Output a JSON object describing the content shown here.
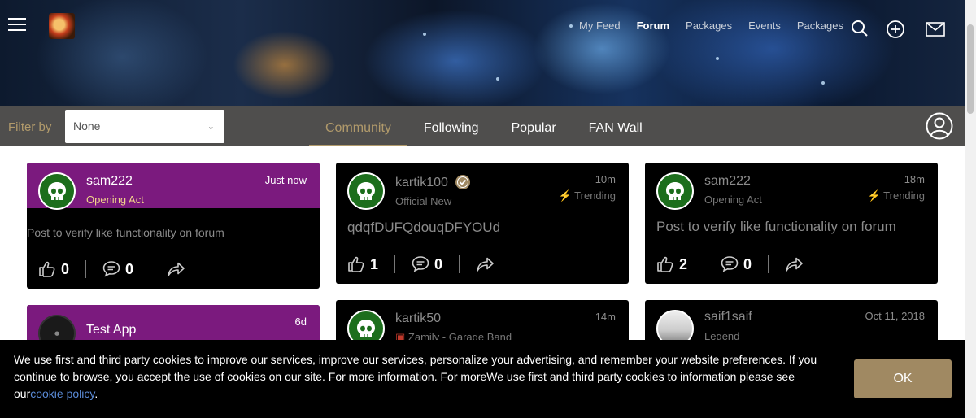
{
  "header": {
    "nav": [
      {
        "label": "My Feed",
        "active": false
      },
      {
        "label": "Forum",
        "active": true
      },
      {
        "label": "Packages",
        "active": false
      },
      {
        "label": "Events",
        "active": false
      },
      {
        "label": "Packages",
        "active": false
      }
    ],
    "icons": [
      "menu-icon",
      "search-icon",
      "add-icon",
      "mail-icon"
    ]
  },
  "filter": {
    "label": "Filter by",
    "selected": "None"
  },
  "tabs": [
    {
      "label": "Community",
      "active": true
    },
    {
      "label": "Following",
      "active": false
    },
    {
      "label": "Popular",
      "active": false
    },
    {
      "label": "FAN Wall",
      "active": false
    }
  ],
  "cards": [
    {
      "user": "sam222",
      "role": "Opening Act",
      "time": "Just now",
      "body": "Post to verify like functionality on forum",
      "likes": "0",
      "comments": "0"
    },
    {
      "user": "kartik100",
      "role": "Official New",
      "time": "10m",
      "trend": "Trending",
      "body": "qdqfDUFQdouqDFYOUd",
      "likes": "1",
      "comments": "0"
    },
    {
      "user": "sam222",
      "role": "Opening Act",
      "time": "18m",
      "trend": "Trending",
      "body": "Post to verify like functionality on forum",
      "likes": "2",
      "comments": "0"
    },
    {
      "user": "Test App",
      "time": "6d"
    },
    {
      "user": "kartik50",
      "role": "Zamily - Garage Band",
      "time": "14m"
    },
    {
      "user": "saif1saif",
      "role": "Legend",
      "time": "Oct 11, 2018"
    }
  ],
  "cookie": {
    "text": "We use first and third party cookies to improve our services, improve our services, personalize your advertising, and remember your website preferences. If you continue to browse, you accept the use of cookies on our site. For more information. For moreWe use first and third party cookies to information please see our",
    "link": "cookie policy",
    "after": ".",
    "button": "OK"
  },
  "colors": {
    "accent": "#b19a6b",
    "purple": "#7b1a7e",
    "avatar": "#1c6e1c",
    "link": "#5a8ad6"
  }
}
